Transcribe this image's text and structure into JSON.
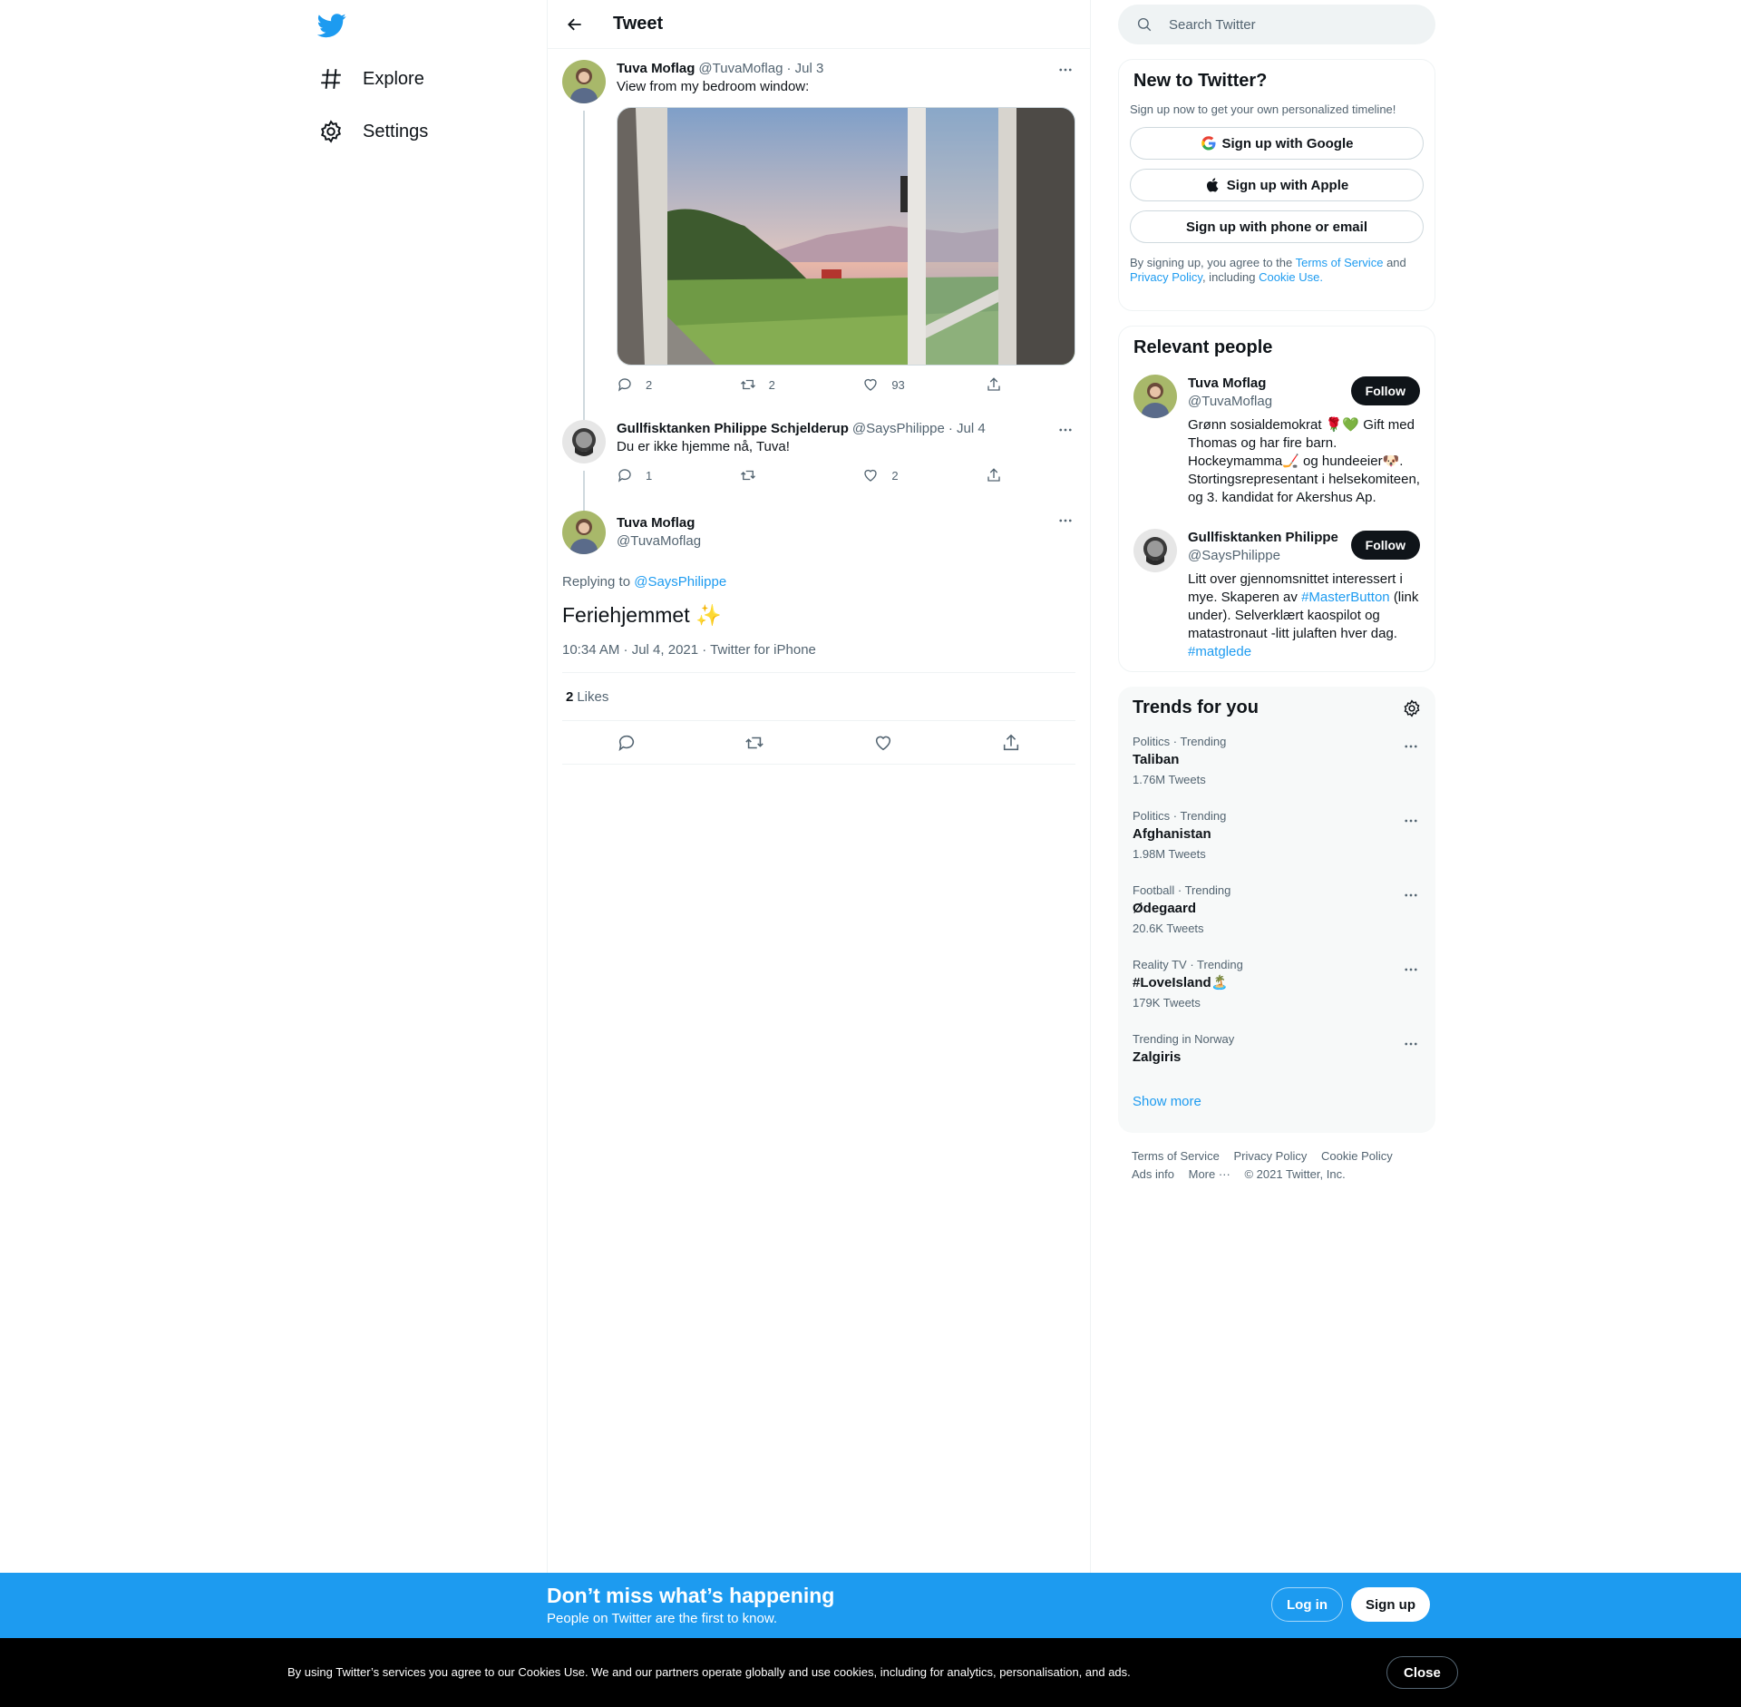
{
  "nav": {
    "explore": "Explore",
    "settings": "Settings"
  },
  "header": {
    "title": "Tweet"
  },
  "tweets": [
    {
      "name": "Tuva Moflag",
      "handle": "@TuvaMoflag",
      "date": "· Jul 3",
      "text": "View from my bedroom window:",
      "replies": "2",
      "retweets": "2",
      "likes": "93"
    },
    {
      "name": "Gullfisktanken Philippe Schjelderup",
      "handle": "@SaysPhilippe",
      "date": "· Jul 4",
      "text": "Du er ikke hjemme nå, Tuva!",
      "replies": "1",
      "retweets": "",
      "likes": "2"
    }
  ],
  "focus": {
    "name": "Tuva Moflag",
    "handle": "@TuvaMoflag",
    "replying_label": "Replying to",
    "replying_to": "@SaysPhilippe",
    "text": "Feriehjemmet",
    "emoji": "✨",
    "timestamp": "10:34 AM · Jul 4, 2021 · Twitter for iPhone",
    "likes_count": "2",
    "likes_label": "Likes"
  },
  "search": {
    "placeholder": "Search Twitter"
  },
  "signup_card": {
    "title": "New to Twitter?",
    "subtitle": "Sign up now to get your own personalized timeline!",
    "google": "Sign up with Google",
    "apple": "Sign up with Apple",
    "phone": "Sign up with phone or email",
    "legal_1": "By signing up, you agree to the",
    "terms": "Terms of Service",
    "legal_2": "and",
    "privacy": "Privacy Policy",
    "legal_3": ", including",
    "cookie": "Cookie Use."
  },
  "relevant": {
    "title": "Relevant people",
    "people": [
      {
        "name": "Tuva Moflag",
        "handle": "@TuvaMoflag",
        "bio": "Grønn sosialdemokrat 🌹💚 Gift med Thomas og har fire barn. Hockeymamma🏒 og hundeeier🐶. Stortingsrepresentant i helsekomiteen, og 3. kandidat for Akershus Ap.",
        "follow": "Follow"
      },
      {
        "name": "Gullfisktanken Philippe",
        "handle": "@SaysPhilippe",
        "bio_1": "Litt over gjennomsnittet interessert i mye. Skaperen av",
        "bio_link": "#MasterButton",
        "bio_2": "(link under). Selverklært kaospilot og matastronaut -litt julaften hver dag.",
        "bio_link_2": "#matglede",
        "follow": "Follow"
      }
    ]
  },
  "trends": {
    "title": "Trends for you",
    "items": [
      {
        "meta": "Politics · Trending",
        "name": "Taliban",
        "count": "1.76M Tweets"
      },
      {
        "meta": "Politics · Trending",
        "name": "Afghanistan",
        "count": "1.98M Tweets"
      },
      {
        "meta": "Football · Trending",
        "name": "Ødegaard",
        "count": "20.6K Tweets"
      },
      {
        "meta": "Reality TV · Trending",
        "name": "#LoveIsland🏝️",
        "count": "179K Tweets"
      },
      {
        "meta": "Trending in Norway",
        "name": "Zalgiris",
        "count": ""
      }
    ],
    "show_more": "Show more"
  },
  "footer": {
    "terms": "Terms of Service",
    "privacy": "Privacy Policy",
    "cookie": "Cookie Policy",
    "ads": "Ads info",
    "more": "More ···",
    "copyright": "© 2021 Twitter, Inc."
  },
  "signup_bar": {
    "headline": "Don’t miss what’s happening",
    "sub": "People on Twitter are the first to know.",
    "login": "Log in",
    "signup": "Sign up"
  },
  "cookie_bar": {
    "message": "By using Twitter’s services you agree to our Cookies Use. We and our partners operate globally and use cookies, including for analytics, personalisation, and ads.",
    "close": "Close"
  },
  "colors": {
    "accent": "#1d9bf0",
    "text": "#0f1419",
    "muted": "#536471"
  }
}
